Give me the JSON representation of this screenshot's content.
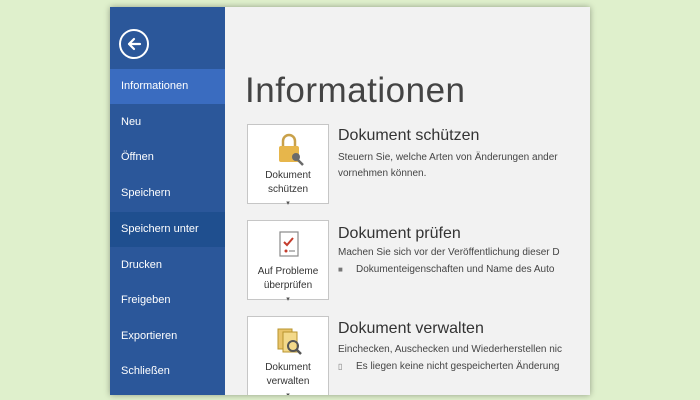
{
  "sidebar": {
    "items": [
      {
        "label": "Informationen"
      },
      {
        "label": "Neu"
      },
      {
        "label": "Öffnen"
      },
      {
        "label": "Speichern"
      },
      {
        "label": "Speichern unter"
      },
      {
        "label": "Drucken"
      },
      {
        "label": "Freigeben"
      },
      {
        "label": "Exportieren"
      },
      {
        "label": "Schließen"
      }
    ],
    "active": "Informationen",
    "color": "#2b579a"
  },
  "main": {
    "title": "Informationen",
    "sections": [
      {
        "button_line1": "Dokument",
        "button_line2": "schützen",
        "icon": "lock-key-icon",
        "title": "Dokument schützen",
        "line1": "Steuern Sie, welche Arten von Änderungen ander",
        "line2": "vornehmen können."
      },
      {
        "button_line1": "Auf Probleme",
        "button_line2": "überprüfen",
        "icon": "inspect-document-icon",
        "title": "Dokument prüfen",
        "line1": "Machen Sie sich vor der Veröffentlichung dieser D",
        "bullet": "Dokumenteigenschaften und Name des Auto"
      },
      {
        "button_line1": "Dokument",
        "button_line2": "verwalten",
        "icon": "manage-document-icon",
        "title": "Dokument verwalten",
        "line1": "Einchecken, Auschecken und Wiederherstellen nic",
        "bullet": "Es liegen keine nicht gespeicherten Änderung"
      }
    ]
  }
}
